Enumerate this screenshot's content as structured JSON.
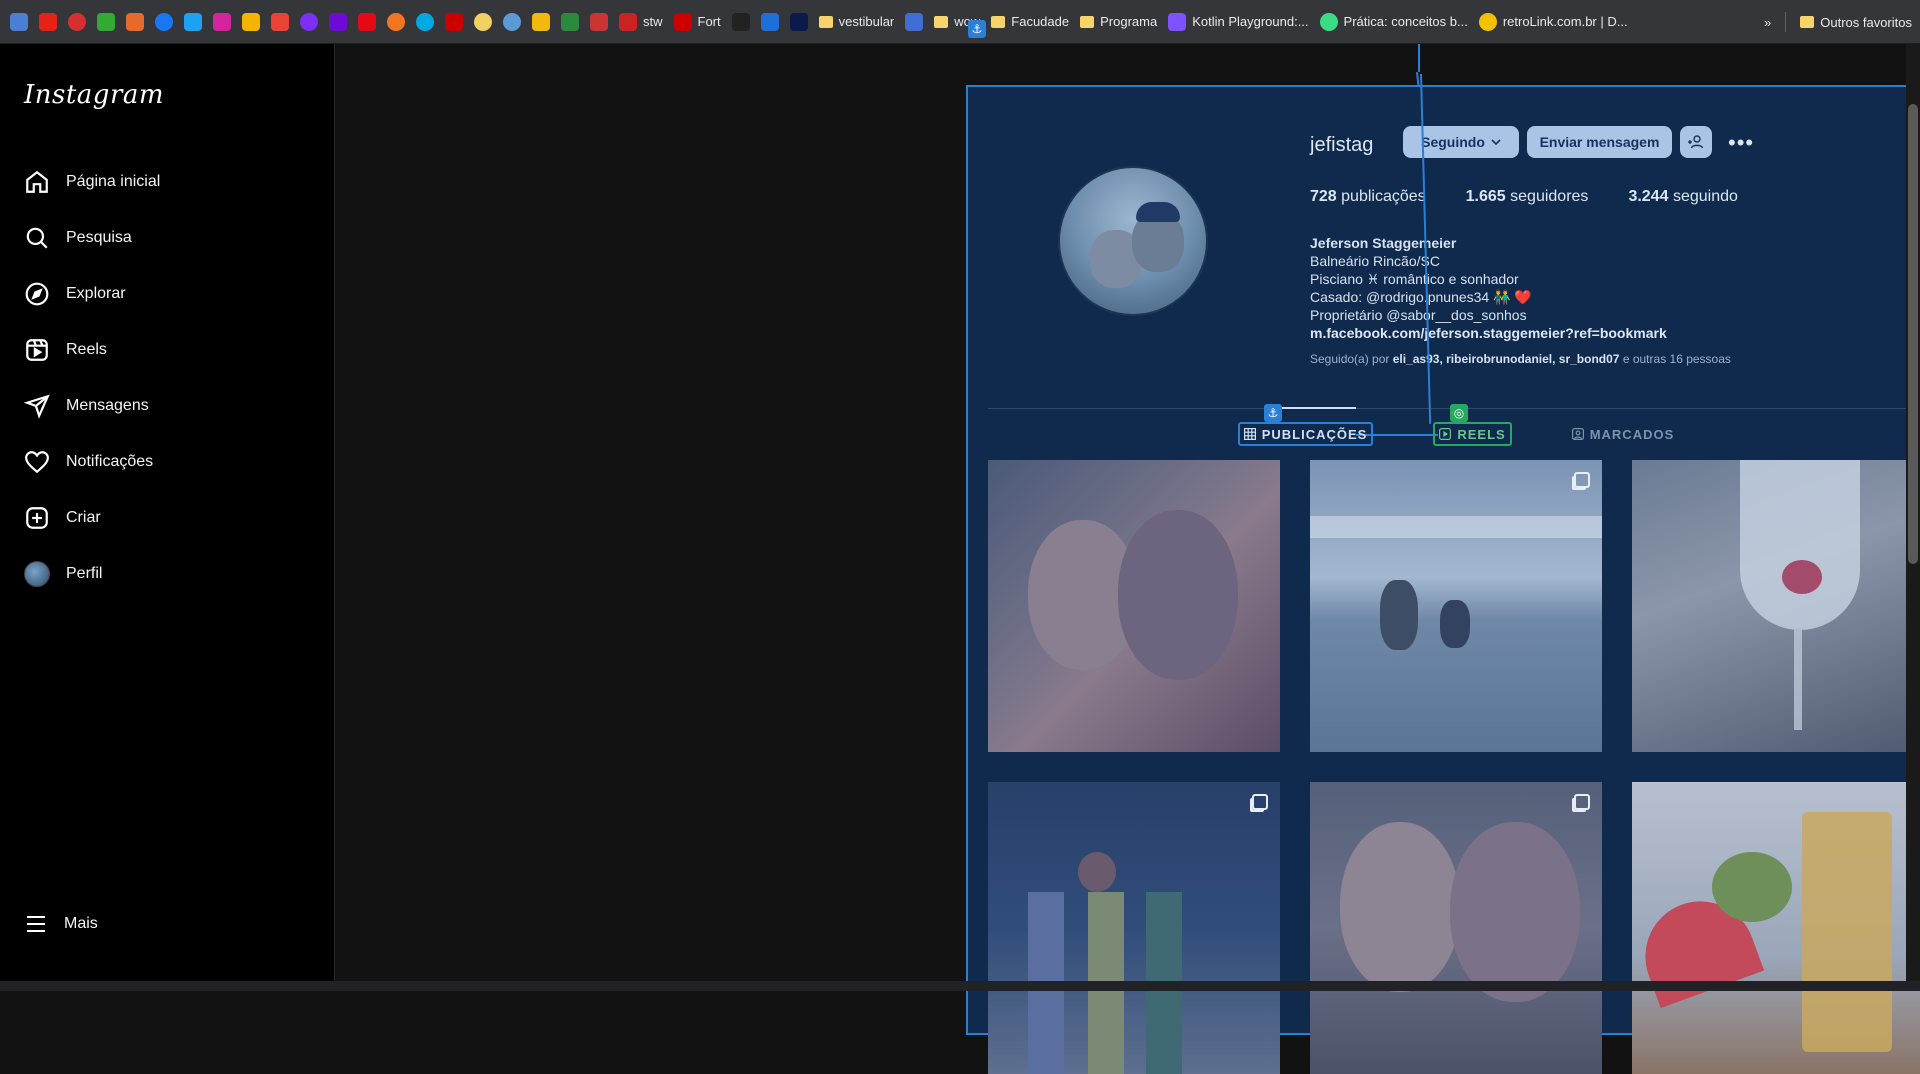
{
  "bookmarks": {
    "items": [
      {
        "label": "stw"
      },
      {
        "label": "Fort"
      },
      {
        "label": "vestibular"
      },
      {
        "label": "wow"
      },
      {
        "label": "Facudade"
      },
      {
        "label": "Programa"
      },
      {
        "label": "Kotlin Playground:..."
      },
      {
        "label": "Prática: conceitos b..."
      },
      {
        "label": "retroLink.com.br | D..."
      }
    ],
    "overflow": "»",
    "other_favorites": "Outros favoritos"
  },
  "sidebar": {
    "logo": "Instagram",
    "items": [
      {
        "label": "Página inicial",
        "icon": "home-icon"
      },
      {
        "label": "Pesquisa",
        "icon": "search-icon"
      },
      {
        "label": "Explorar",
        "icon": "compass-icon"
      },
      {
        "label": "Reels",
        "icon": "reels-icon"
      },
      {
        "label": "Mensagens",
        "icon": "send-icon"
      },
      {
        "label": "Notificações",
        "icon": "heart-icon"
      },
      {
        "label": "Criar",
        "icon": "plus-square-icon"
      },
      {
        "label": "Perfil",
        "icon": "avatar"
      }
    ],
    "more": "Mais"
  },
  "profile": {
    "username": "jefistag",
    "following_button": "Seguindo",
    "message_button": "Enviar mensagem",
    "posts_count": "728",
    "posts_label": "publicações",
    "followers_count": "1.665",
    "followers_label": "seguidores",
    "following_count": "3.244",
    "following_label": "seguindo",
    "bio_name": "Jeferson Staggemeier",
    "bio_lines": [
      "Balneário Rincão/SC",
      "Pisciano ♓ romântico e sonhador",
      "Casado: @rodrigo.pnunes34 👬 ❤️",
      "Proprietário @sabor__dos_sonhos"
    ],
    "bio_link": "m.facebook.com/jeferson.staggemeier?ref=bookmark",
    "followed_by_prefix": "Seguido(a) por",
    "followed_by_users": "eli_as93, ribeirobrunodaniel, sr_bond07",
    "followed_by_suffix": "e outras 16 pessoas"
  },
  "tabs": [
    {
      "label": "PUBLICAÇÕES",
      "icon": "grid-icon"
    },
    {
      "label": "REELS",
      "icon": "reels-icon"
    },
    {
      "label": "MARCADOS",
      "icon": "tag-icon"
    }
  ],
  "colors": {
    "selection_overlay": "#102c52",
    "selection_border": "#2a7fd6",
    "reels_highlight": "#27a860"
  }
}
